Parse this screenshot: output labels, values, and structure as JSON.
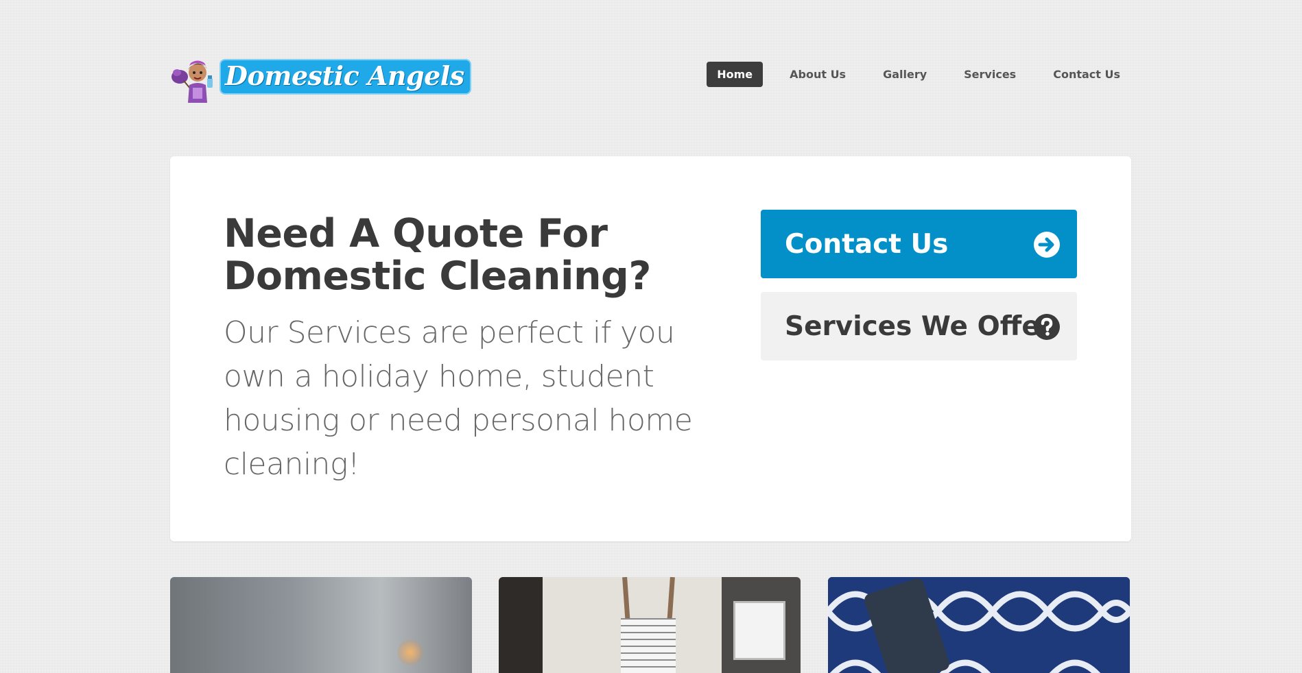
{
  "brand": {
    "name": "Domestic Angels",
    "logo_icon": "cleaning-lady-mascot-icon"
  },
  "nav": {
    "items": [
      {
        "label": "Home",
        "active": true
      },
      {
        "label": "About Us",
        "active": false
      },
      {
        "label": "Gallery",
        "active": false
      },
      {
        "label": "Services",
        "active": false
      },
      {
        "label": "Contact Us",
        "active": false
      }
    ]
  },
  "hero": {
    "title_line1": "Need A Quote For",
    "title_line2": "Domestic Cleaning?",
    "subtitle": "Our Services are perfect if you own a holiday home, student housing or need personal home cleaning!",
    "primary_button": {
      "label": "Contact Us",
      "icon": "arrow-right-circle-icon"
    },
    "secondary_button": {
      "label": "Services We Offer",
      "icon": "question-circle-icon"
    }
  },
  "colors": {
    "accent": "#0390c8",
    "nav_active_bg": "#3d3d3d",
    "logo_bg": "#1fa9e8",
    "page_bg": "#ebebeb"
  },
  "cards": [
    {
      "image": "dim-room-with-lamp-photo"
    },
    {
      "image": "bathroom-ladder-towel-photo"
    },
    {
      "image": "vacuum-on-blue-rug-photo"
    }
  ]
}
